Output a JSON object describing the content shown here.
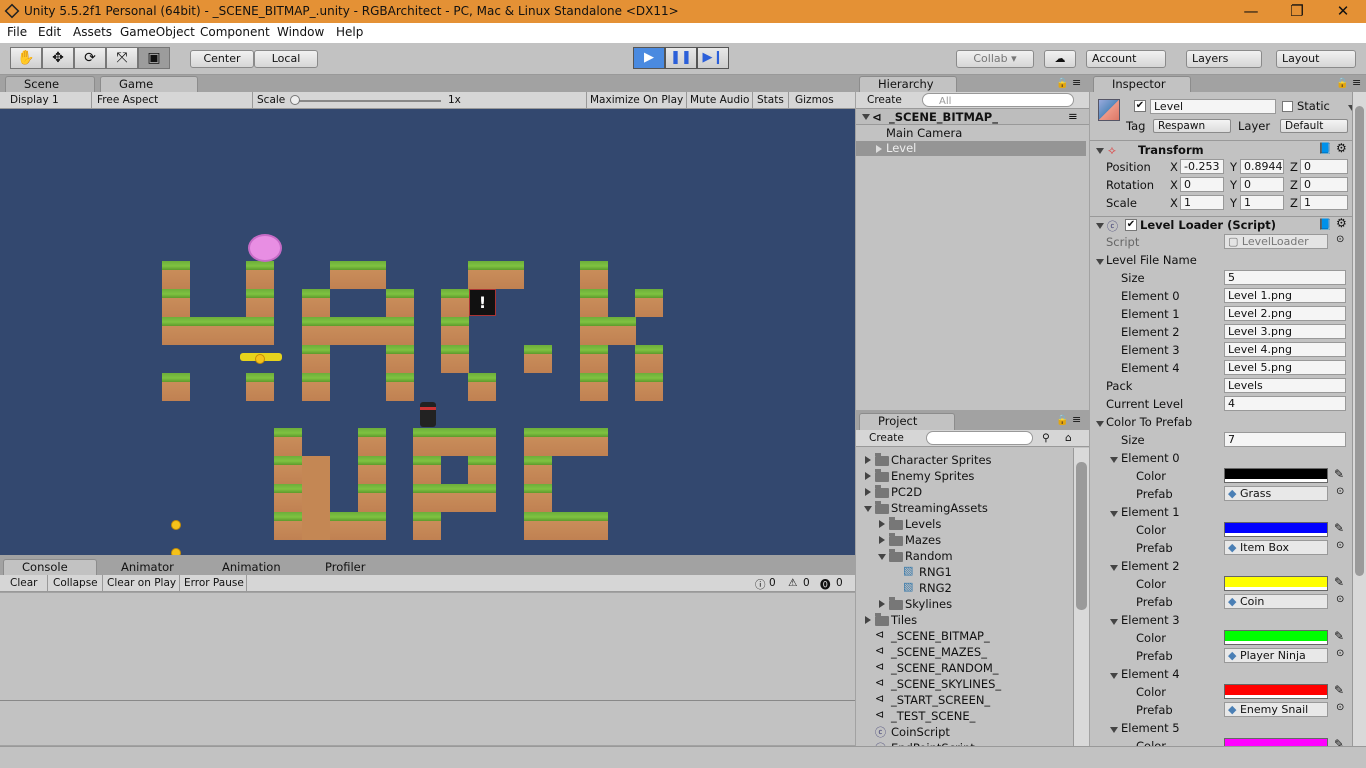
{
  "window": {
    "title": "Unity 5.5.2f1 Personal (64bit) - _SCENE_BITMAP_.unity - RGBArchitect - PC, Mac & Linux Standalone <DX11>",
    "minimize": "—",
    "restore": "❐",
    "close": "✕"
  },
  "menu": [
    "File",
    "Edit",
    "Assets",
    "GameObject",
    "Component",
    "Window",
    "Help"
  ],
  "toolbar": {
    "center_label": "Center",
    "local_label": "Local",
    "collab_label": "Collab",
    "account_label": "Account",
    "layers_label": "Layers",
    "layout_label": "Layout"
  },
  "scene_tabs": {
    "scene": "Scene",
    "game": "Game"
  },
  "game_bar": {
    "display": "Display 1",
    "aspect": "Free Aspect",
    "scale_label": "Scale",
    "scale_value": "1x",
    "maximize": "Maximize On Play",
    "mute": "Mute Audio",
    "stats": "Stats",
    "gizmos": "Gizmos"
  },
  "bottom_tabs": {
    "console": "Console",
    "animator": "Animator",
    "animation": "Animation",
    "profiler": "Profiler"
  },
  "console_bar": {
    "clear": "Clear",
    "collapse": "Collapse",
    "clear_on_play": "Clear on Play",
    "error_pause": "Error Pause",
    "info_count": "0",
    "warn_count": "0",
    "error_count": "0"
  },
  "hierarchy": {
    "tab": "Hierarchy",
    "create": "Create",
    "search_placeholder": "All",
    "scene": "_SCENE_BITMAP_",
    "items": [
      "Main Camera",
      "Level"
    ]
  },
  "project": {
    "tab": "Project",
    "create": "Create",
    "items": [
      "Character Sprites",
      "Enemy Sprites",
      "PC2D",
      "StreamingAssets",
      "Levels",
      "Mazes",
      "Random",
      "RNG1",
      "RNG2",
      "Skylines",
      "Tiles",
      "_SCENE_BITMAP_",
      "_SCENE_MAZES_",
      "_SCENE_RANDOM_",
      "_SCENE_SKYLINES_",
      "_START_SCREEN_",
      "_TEST_SCENE_",
      "CoinScript",
      "EndPointScript"
    ]
  },
  "inspector": {
    "tab": "Inspector",
    "name": "Level",
    "static_label": "Static",
    "tag_label": "Tag",
    "tag_value": "Respawn",
    "layer_label": "Layer",
    "layer_value": "Default",
    "transform": {
      "title": "Transform",
      "position_label": "Position",
      "rotation_label": "Rotation",
      "scale_label": "Scale",
      "x": "X",
      "y": "Y",
      "z": "Z",
      "position": [
        "-0.253",
        "0.8944",
        "0"
      ],
      "rotation": [
        "0",
        "0",
        "0"
      ],
      "scale": [
        "1",
        "1",
        "1"
      ]
    },
    "level_loader": {
      "title": "Level Loader (Script)",
      "script_label": "Script",
      "script_value": "LevelLoader",
      "level_file_name": "Level File Name",
      "size_label": "Size",
      "size_value": "5",
      "elements": [
        {
          "label": "Element 0",
          "value": "Level 1.png"
        },
        {
          "label": "Element 1",
          "value": "Level 2.png"
        },
        {
          "label": "Element 2",
          "value": "Level 3.png"
        },
        {
          "label": "Element 3",
          "value": "Level 4.png"
        },
        {
          "label": "Element 4",
          "value": "Level 5.png"
        }
      ],
      "pack_label": "Pack",
      "pack_value": "Levels",
      "current_level_label": "Current Level",
      "current_level_value": "4",
      "color_to_prefab": "Color To Prefab",
      "ctp_size_value": "7",
      "color_label": "Color",
      "prefab_label": "Prefab",
      "ctp_elements": [
        {
          "label": "Element 0",
          "color": "#000000",
          "prefab": "Grass"
        },
        {
          "label": "Element 1",
          "color": "#0000ff",
          "prefab": "Item Box"
        },
        {
          "label": "Element 2",
          "color": "#ffff00",
          "prefab": "Coin"
        },
        {
          "label": "Element 3",
          "color": "#00ff00",
          "prefab": "Player Ninja"
        },
        {
          "label": "Element 4",
          "color": "#ff0000",
          "prefab": "Enemy Snail"
        },
        {
          "label": "Element 5",
          "color": "#ff00ff",
          "prefab": ""
        }
      ]
    }
  },
  "colors": {
    "title_bar": "#e49135",
    "game_bg": "#33486f",
    "play_accent": "#2b5fd9"
  }
}
